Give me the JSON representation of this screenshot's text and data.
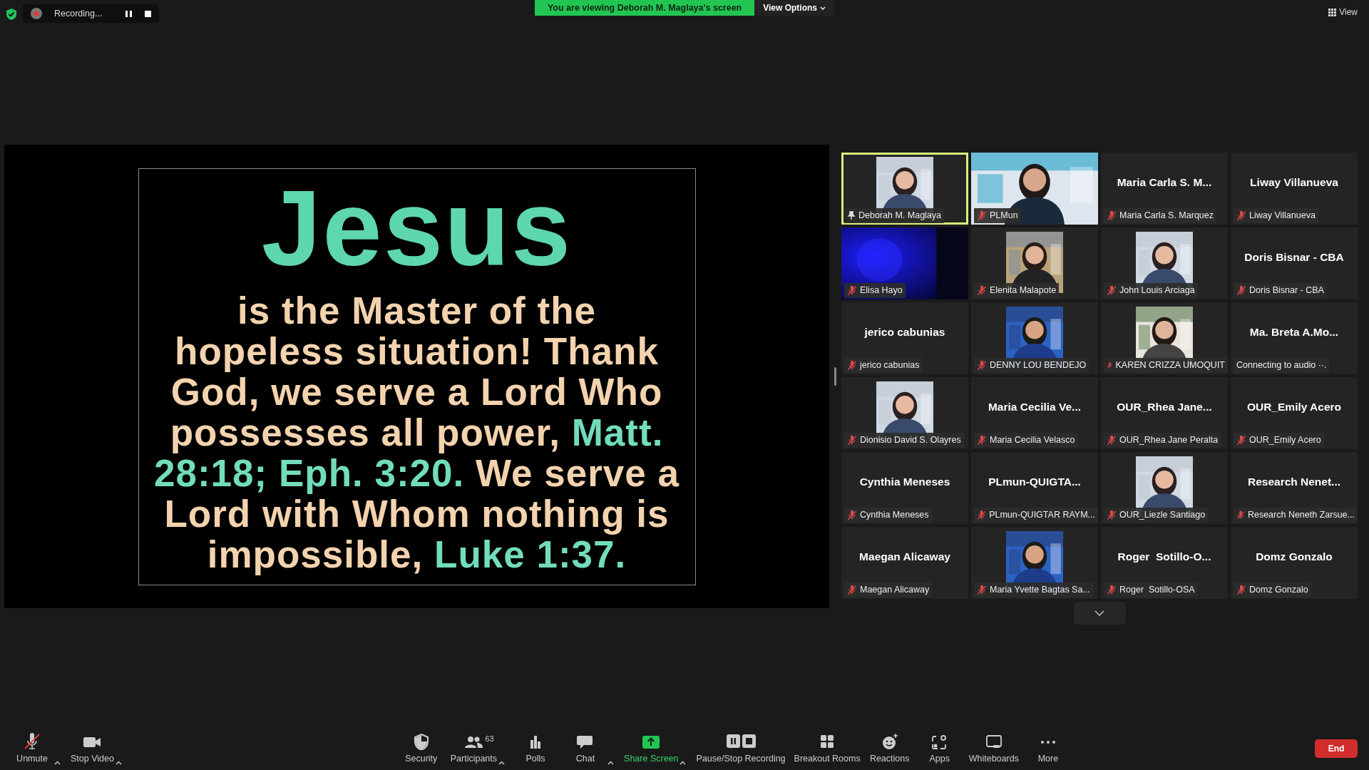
{
  "top_bar": {
    "recording": {
      "label": "Recording..."
    },
    "share_banner": "You are viewing Deborah M. Maglaya's screen",
    "view_options": "View Options",
    "view_button": "View"
  },
  "shared_screen": {
    "title": "Jesus",
    "segments": [
      {
        "text": "is the Master of the hopeless situation! Thank God, we serve a Lord Who possesses all power, ",
        "color": "#f3d3ae"
      },
      {
        "text": "Matt. 28:18; Eph. 3:20.",
        "color": "#72dcbd"
      },
      {
        "text": " We serve a Lord with Whom nothing is impossible, ",
        "color": "#f3d3ae"
      },
      {
        "text": "Luke 1:37.",
        "color": "#72dcbd"
      }
    ]
  },
  "gallery": {
    "tiles": [
      {
        "label": "Deborah M. Maglaya",
        "muted": false,
        "pinned": true,
        "speaking": true
      },
      {
        "kind": "video",
        "label": "PLMun",
        "muted": true,
        "pinned": false,
        "speaking": false
      },
      {
        "kind": "name",
        "display_name": "Maria Carla S. M...",
        "label": "Maria Carla S. Marquez",
        "muted": true,
        "pinned": false,
        "speaking": false
      },
      {
        "kind": "name",
        "display_name": "Liway Villanueva",
        "label": "Liway Villanueva",
        "muted": true,
        "pinned": false,
        "speaking": false
      },
      {
        "kind": "video",
        "label": "Elisa Hayo",
        "muted": true,
        "pinned": false,
        "speaking": false
      },
      {
        "label": "Elenita Malapote",
        "muted": true,
        "pinned": false,
        "speaking": false
      },
      {
        "label": "John Louis Arciaga",
        "muted": true,
        "pinned": false,
        "speaking": false
      },
      {
        "kind": "name",
        "display_name": "Doris Bisnar - CBA",
        "label": "Doris Bisnar - CBA",
        "muted": true,
        "pinned": false,
        "speaking": false
      },
      {
        "kind": "name",
        "display_name": "jerico cabunias",
        "label": "jerico cabunias",
        "muted": true,
        "pinned": false,
        "speaking": false
      },
      {
        "label": "DENNY LOU BENDEJO",
        "muted": true,
        "pinned": false,
        "speaking": false
      },
      {
        "label": "KAREN CRIZZA UMOQUIT",
        "muted": true,
        "pinned": false,
        "speaking": false
      },
      {
        "kind": "name",
        "display_name": "Ma. Breta A.Mo...",
        "label": "Connecting to audio ··.",
        "muted": false,
        "pinned": false,
        "speaking": false
      },
      {
        "label": "Dionisio David S. Olayres",
        "muted": true,
        "pinned": false,
        "speaking": false
      },
      {
        "kind": "name",
        "display_name": "Maria Cecilia Ve...",
        "label": "Maria Cecilia Velasco",
        "muted": true,
        "pinned": false,
        "speaking": false
      },
      {
        "kind": "name",
        "display_name": "OUR_Rhea Jane...",
        "label": "OUR_Rhea Jane Peralta",
        "muted": true,
        "pinned": false,
        "speaking": false
      },
      {
        "kind": "name",
        "display_name": "OUR_Emily Acero",
        "label": "OUR_Emily Acero",
        "muted": true,
        "pinned": false,
        "speaking": false
      },
      {
        "kind": "name",
        "display_name": "Cynthia Meneses",
        "label": "Cynthia Meneses",
        "muted": true,
        "pinned": false,
        "speaking": false
      },
      {
        "kind": "name",
        "display_name": "PLmun-QUIGTA...",
        "label": "PLmun-QUIGTAR RAYM...",
        "muted": true,
        "pinned": false,
        "speaking": false
      },
      {
        "label": "OUR_Liezle Santiago",
        "muted": true,
        "pinned": false,
        "speaking": false
      },
      {
        "kind": "name",
        "display_name": "Research Nenet...",
        "label": "Research Neneth Zarsue...",
        "muted": true,
        "pinned": false,
        "speaking": false
      },
      {
        "kind": "name",
        "display_name": "Maegan Alicaway",
        "label": "Maegan Alicaway",
        "muted": true,
        "pinned": false,
        "speaking": false
      },
      {
        "label": "Maria Yvette Bagtas Sa...",
        "muted": true,
        "pinned": false,
        "speaking": false
      },
      {
        "kind": "name",
        "display_name": "Roger  Sotillo-O...",
        "label": "Roger  Sotillo-OSA",
        "muted": true,
        "pinned": false,
        "speaking": false
      },
      {
        "kind": "name",
        "display_name": "Domz Gonzalo",
        "label": "Domz Gonzalo",
        "muted": true,
        "pinned": false,
        "speaking": false
      }
    ]
  },
  "toolbar": {
    "items": [
      {
        "kind": "audio",
        "label": "Unmute",
        "caret": true,
        "muted": true
      },
      {
        "kind": "video",
        "label": "Stop Video",
        "caret": true
      },
      {
        "kind": "security",
        "label": "Security",
        "caret": false
      },
      {
        "kind": "participants",
        "label": "Participants",
        "count": "63",
        "caret": true
      },
      {
        "kind": "polls",
        "label": "Polls",
        "caret": false
      },
      {
        "kind": "chat",
        "label": "Chat",
        "caret": true
      },
      {
        "kind": "share",
        "label": "Share Screen",
        "caret": true
      },
      {
        "kind": "recording",
        "label": "Pause/Stop Recording",
        "caret": false
      },
      {
        "kind": "breakout",
        "label": "Breakout Rooms",
        "caret": false
      },
      {
        "kind": "reactions",
        "label": "Reactions",
        "caret": false
      },
      {
        "kind": "apps",
        "label": "Apps",
        "caret": false
      },
      {
        "kind": "whiteboards",
        "label": "Whiteboards",
        "caret": false
      },
      {
        "kind": "more",
        "label": "More",
        "caret": false
      }
    ],
    "end_button": "End"
  }
}
